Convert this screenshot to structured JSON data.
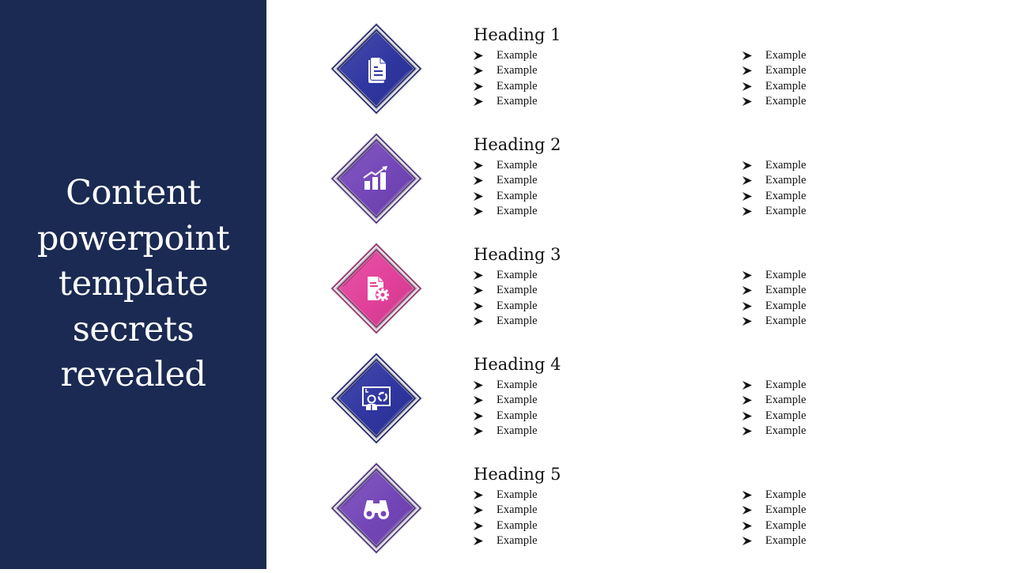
{
  "slide": {
    "title_lines": [
      "Content",
      "powerpoint",
      "template",
      "secrets",
      "revealed"
    ],
    "colors": {
      "panel": "#1b2a52",
      "blue": "#2f36a0",
      "purple": "#7446b8",
      "pink": "#e2409a",
      "text": "#111111",
      "title_text": "#ffffff"
    },
    "sections": [
      {
        "heading": "Heading 1",
        "icon": "documents-icon",
        "color": "#2f36a0",
        "col1": [
          "Example",
          "Example",
          "Example",
          "Example"
        ],
        "col2": [
          "Example",
          "Example",
          "Example",
          "Example"
        ]
      },
      {
        "heading": "Heading 2",
        "icon": "growth-chart-icon",
        "color": "#7446b8",
        "col1": [
          "Example",
          "Example",
          "Example",
          "Example"
        ],
        "col2": [
          "Example",
          "Example",
          "Example",
          "Example"
        ]
      },
      {
        "heading": "Heading 3",
        "icon": "document-settings-icon",
        "color": "#e2409a",
        "col1": [
          "Example",
          "Example",
          "Example",
          "Example"
        ],
        "col2": [
          "Example",
          "Example",
          "Example",
          "Example"
        ]
      },
      {
        "heading": "Heading 4",
        "icon": "presentation-board-icon",
        "color": "#2f36a0",
        "col1": [
          "Example",
          "Example",
          "Example",
          "Example"
        ],
        "col2": [
          "Example",
          "Example",
          "Example",
          "Example"
        ]
      },
      {
        "heading": "Heading 5",
        "icon": "binoculars-icon",
        "color": "#7446b8",
        "col1": [
          "Example",
          "Example",
          "Example",
          "Example"
        ],
        "col2": [
          "Example",
          "Example",
          "Example",
          "Example"
        ]
      }
    ]
  }
}
